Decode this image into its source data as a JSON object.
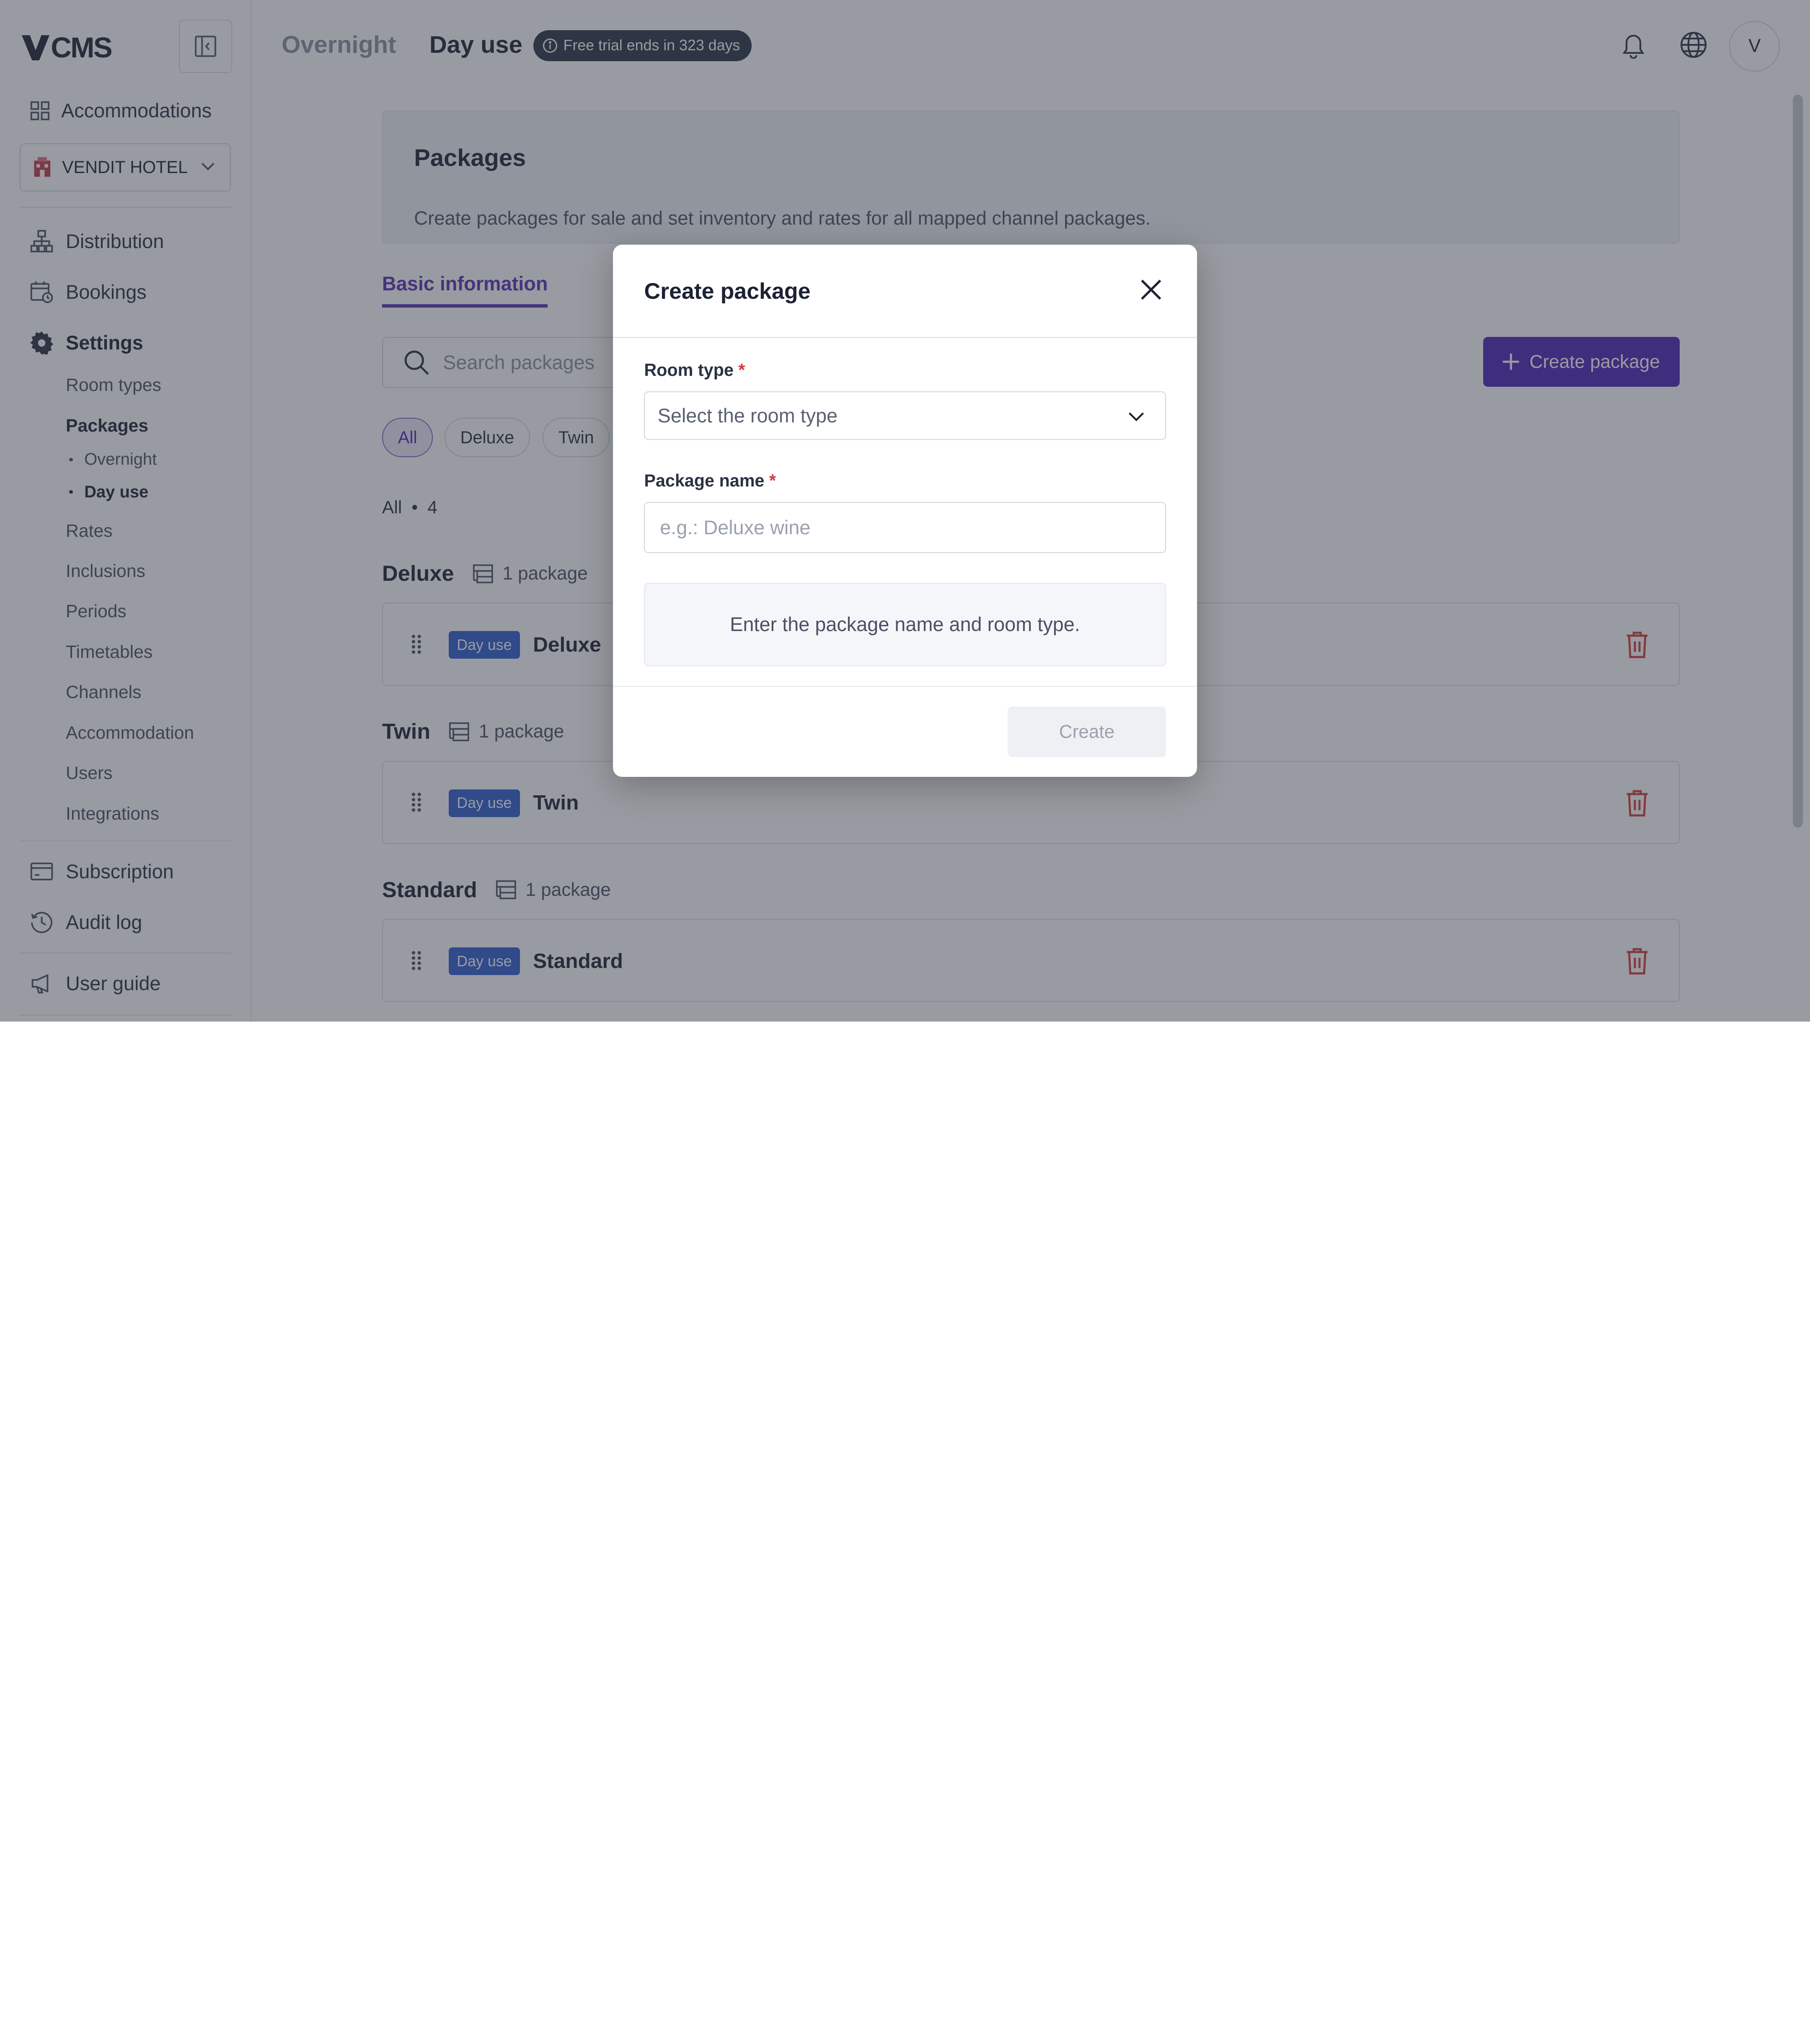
{
  "app": {
    "logo_text": "CMS",
    "logo_mark": "V"
  },
  "sidebar": {
    "accommodations": "Accommodations",
    "hotel": "VENDIT HOTEL",
    "items": [
      {
        "label": "Distribution",
        "icon": "sitemap-icon"
      },
      {
        "label": "Bookings",
        "icon": "calendar-icon"
      },
      {
        "label": "Settings",
        "icon": "gear-icon"
      }
    ],
    "settings_sub": [
      "Room types",
      "Packages",
      "Rates",
      "Inclusions",
      "Periods",
      "Timetables",
      "Channels",
      "Accommodation",
      "Users",
      "Integrations"
    ],
    "packages_sub": [
      "Overnight",
      "Day use"
    ],
    "subscription": "Subscription",
    "audit_log": "Audit log",
    "user_guide": "User guide"
  },
  "header": {
    "tab_overnight": "Overnight",
    "tab_dayuse": "Day use",
    "trial": "Free trial ends in 323 days",
    "avatar": "V"
  },
  "main": {
    "title": "Packages",
    "description": "Create packages for sale and set inventory and rates for all mapped channel packages.",
    "tab_basic": "Basic information",
    "search_placeholder": "Search packages",
    "create_button": "Create package",
    "chips": [
      "All",
      "Deluxe",
      "Twin"
    ],
    "count_label": "All",
    "count_value": "4",
    "groups": [
      {
        "title": "Deluxe",
        "count": "1 package",
        "badge": "Day use",
        "name": "Deluxe"
      },
      {
        "title": "Twin",
        "count": "1 package",
        "badge": "Day use",
        "name": "Twin"
      },
      {
        "title": "Standard",
        "count": "1 package",
        "badge": "Day use",
        "name": "Standard"
      }
    ]
  },
  "modal": {
    "title": "Create package",
    "room_type_label": "Room type",
    "required_mark": "*",
    "room_type_placeholder": "Select the room type",
    "package_name_label": "Package name",
    "package_name_placeholder": "e.g.: Deluxe wine",
    "hint": "Enter the package name and room type.",
    "create": "Create"
  },
  "colors": {
    "accent": "#4c22b8",
    "badge": "#2f5dd0",
    "danger": "#d23b3b"
  }
}
